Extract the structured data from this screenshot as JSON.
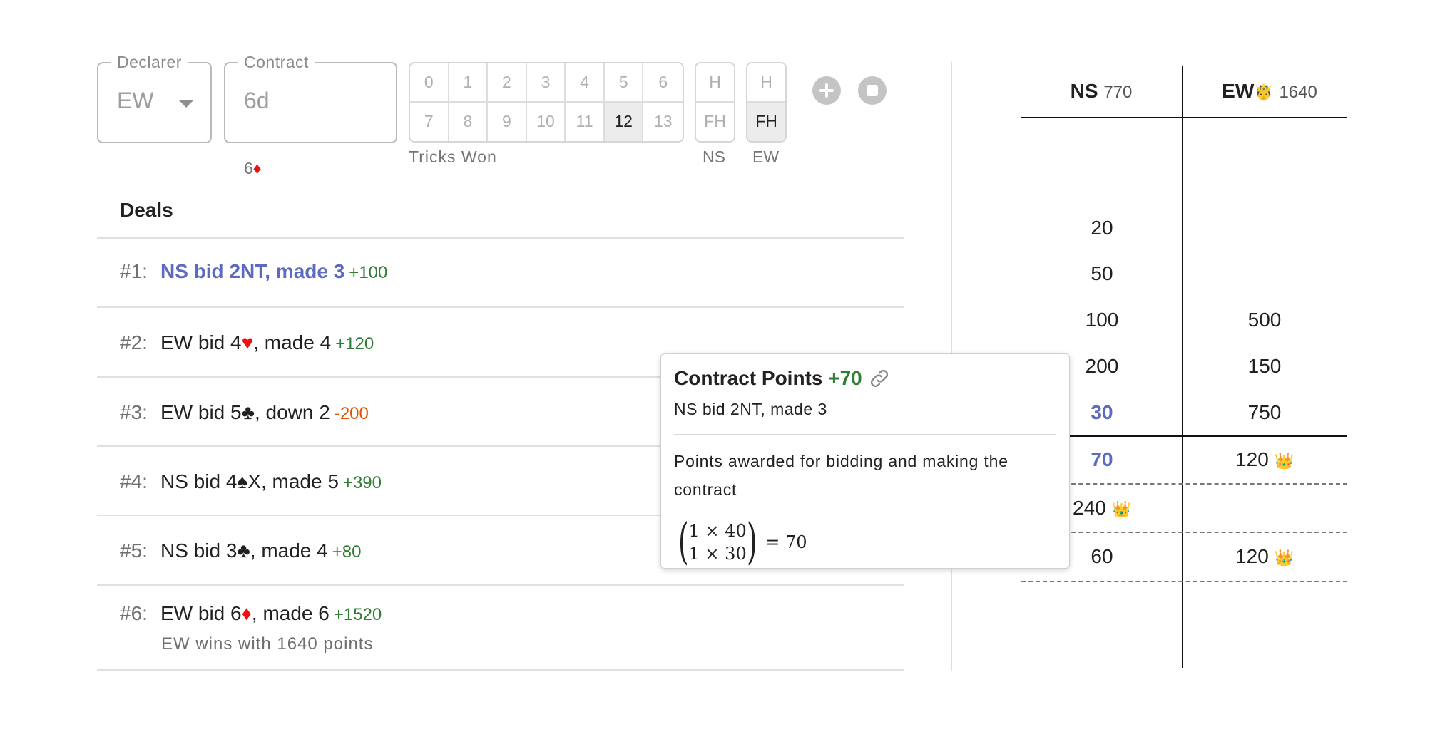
{
  "declarer": {
    "label": "Declarer",
    "value": "EW"
  },
  "contract": {
    "label": "Contract",
    "value": "6d",
    "helper_level": "6",
    "helper_suit": "♦"
  },
  "tricks": {
    "row1": [
      "0",
      "1",
      "2",
      "3",
      "4",
      "5",
      "6"
    ],
    "row2": [
      "7",
      "8",
      "9",
      "10",
      "11",
      "12",
      "13"
    ],
    "selected": "12",
    "caption": "Tricks Won"
  },
  "honors": {
    "ns": {
      "top": "H",
      "bottom": "FH",
      "caption": "NS"
    },
    "ew": {
      "top": "H",
      "bottom": "FH",
      "caption": "EW",
      "selected": "FH"
    }
  },
  "buttons": {
    "add": "add-icon",
    "stop": "stop-icon"
  },
  "deals": {
    "title": "Deals",
    "items": [
      {
        "num": "#1:",
        "pre": "NS bid 2NT, made 3",
        "suit": "",
        "post": "",
        "points": "+100",
        "highlight": true
      },
      {
        "num": "#2:",
        "pre": "EW bid 4",
        "suit": "♥",
        "post": ", made 4",
        "points": "+120"
      },
      {
        "num": "#3:",
        "pre": "EW bid 5",
        "suit": "♣",
        "post": ", down 2",
        "points": "-200"
      },
      {
        "num": "#4:",
        "pre": "NS bid 4",
        "suit": "♠",
        "post": "X, made 5",
        "points": "+390"
      },
      {
        "num": "#5:",
        "pre": "NS bid 3",
        "suit": "♣",
        "post": ", made 4",
        "points": "+80"
      },
      {
        "num": "#6:",
        "pre": "EW bid 6",
        "suit": "♦",
        "post": ", made 6",
        "points": "+1520",
        "note": "EW wins with 1640 points"
      }
    ]
  },
  "score": {
    "ns": {
      "name": "NS",
      "total": "770"
    },
    "ew": {
      "name": "EW",
      "badge": "🤴",
      "total": "1640"
    },
    "above": {
      "ns": [
        "20",
        "50",
        "100",
        "200",
        "30"
      ],
      "ew": [
        "500",
        "150",
        "750"
      ]
    },
    "below": {
      "game1": {
        "ns": "70",
        "ew": "120"
      },
      "game2": {
        "ns": "240"
      },
      "game3": {
        "ns": "60",
        "ew": "120"
      }
    },
    "crown": "👑"
  },
  "popover": {
    "title": "Contract Points",
    "points": "+70",
    "subtitle": "NS bid 2NT, made 3",
    "body": "Points awarded for bidding and making the contract",
    "formula": {
      "r1": "1 × 40",
      "r2": "1 × 30",
      "result": "= 70"
    },
    "link_icon": "link-icon"
  }
}
